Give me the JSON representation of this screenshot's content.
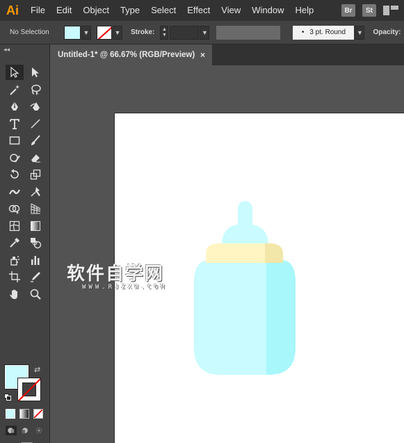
{
  "app": {
    "logo": "Ai",
    "accent": "#ff9a00"
  },
  "menu": {
    "items": [
      {
        "key": "file",
        "label": "File"
      },
      {
        "key": "edit",
        "label": "Edit"
      },
      {
        "key": "object",
        "label": "Object"
      },
      {
        "key": "type",
        "label": "Type"
      },
      {
        "key": "select",
        "label": "Select"
      },
      {
        "key": "effect",
        "label": "Effect"
      },
      {
        "key": "view",
        "label": "View"
      },
      {
        "key": "window",
        "label": "Window"
      },
      {
        "key": "help",
        "label": "Help"
      }
    ],
    "bridge": "Br",
    "stock": "St",
    "workspace_icon": "workspace-grid-icon"
  },
  "control_bar": {
    "selection_label": "No Selection",
    "fill_color": "#c9fbff",
    "stroke_color": "none",
    "stroke_label": "Stroke:",
    "stroke_value": "",
    "brush_label": "3 pt. Round",
    "opacity_label": "Opacity:"
  },
  "document": {
    "tab_title": "Untitled-1* @ 66.67% (RGB/Preview)",
    "close_glyph": "×",
    "artboard_color": "#ffffff"
  },
  "toolbar": {
    "tools": [
      "selection-tool-icon",
      "direct-selection-tool-icon",
      "magic-wand-tool-icon",
      "lasso-tool-icon",
      "pen-tool-icon",
      "curvature-tool-icon",
      "type-tool-icon",
      "line-segment-tool-icon",
      "rectangle-tool-icon",
      "paintbrush-tool-icon",
      "shaper-tool-icon",
      "eraser-tool-icon",
      "rotate-tool-icon",
      "scale-tool-icon",
      "width-tool-icon",
      "free-transform-tool-icon",
      "shape-builder-tool-icon",
      "perspective-grid-tool-icon",
      "mesh-tool-icon",
      "gradient-tool-icon",
      "eyedropper-tool-icon",
      "blend-tool-icon",
      "symbol-sprayer-tool-icon",
      "column-graph-tool-icon",
      "artboard-tool-icon",
      "slice-tool-icon",
      "hand-tool-icon",
      "zoom-tool-icon"
    ],
    "fill_color": "#c9fbff",
    "stroke_color": "none"
  },
  "artwork": {
    "nipple_color": "#c9fbff",
    "collar_color": "#fff5c2",
    "collar_shadow": "#f2e6a8",
    "body_left_color": "#c9fbff",
    "body_right_color": "#a7f7fb"
  },
  "watermark": {
    "main": "软件自学网",
    "sub": "WWW.RJZXW.COM"
  }
}
